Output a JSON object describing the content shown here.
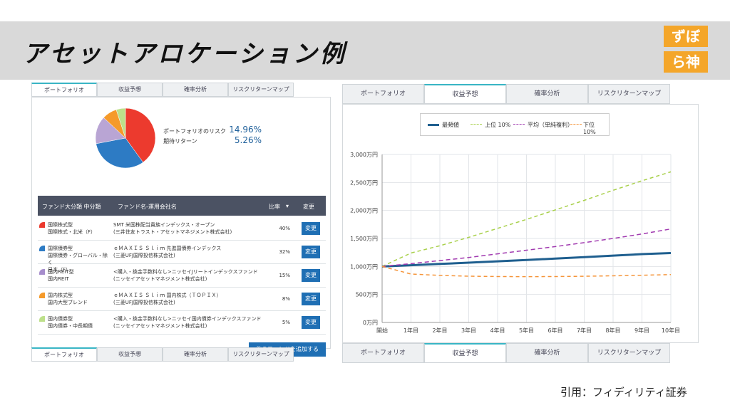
{
  "slide": {
    "title": "アセットアロケーション例",
    "logo_lines": [
      "ずぼ",
      "ら神"
    ],
    "citation": "引用：フィディリティ証券"
  },
  "tabs": [
    "ポートフォリオ",
    "収益予想",
    "確率分析",
    "リスクリターンマップ"
  ],
  "portfolio": {
    "risk_label": "ポートフォリオのリスク",
    "risk_value": "14.96%",
    "return_label": "期待リターン",
    "return_value": "5.26%",
    "pie": [
      {
        "value": 40,
        "color": "#ec3a2e"
      },
      {
        "value": 32,
        "color": "#2d7bc4"
      },
      {
        "value": 15,
        "color": "#b9a5d4"
      },
      {
        "value": 8,
        "color": "#f59a2a"
      },
      {
        "value": 5,
        "color": "#bde08a"
      }
    ],
    "table_headers": {
      "category": "ファンド大分類 中分類",
      "fund": "ファンド名-運用会社名",
      "ratio": "比率",
      "ratio_sort": "▾",
      "change": "変更"
    },
    "rows": [
      {
        "cat1": "国際株式型",
        "cat2": "国際株式・北米（F）",
        "cat3": "",
        "fund1": "SMT 米国株配当貴族インデックス・オープン",
        "fund2": "(三井住友トラスト・アセットマネジメント株式会社)",
        "ratio": "40%",
        "change": "変更",
        "color": "#ec3a2e"
      },
      {
        "cat1": "国際債券型",
        "cat2": "国際債券・グローバル・除く",
        "cat3": "日本（F）",
        "fund1": "ｅＭＡＸＩＳ Ｓｌｉｍ 先進国債券インデックス",
        "fund2": "(三菱UFJ国際投信株式会社)",
        "ratio": "32%",
        "change": "変更",
        "color": "#2d7bc4"
      },
      {
        "cat1": "国内REIT型",
        "cat2": "国内REIT",
        "cat3": "",
        "fund1": "<購入・換金手数料なし>ニッセイJリートインデックスファンド",
        "fund2": "(ニッセイアセットマネジメント株式会社)",
        "ratio": "15%",
        "change": "変更",
        "color": "#a68dcc"
      },
      {
        "cat1": "国内株式型",
        "cat2": "国内大型ブレンド",
        "cat3": "",
        "fund1": "ｅＭＡＸＩＳ Ｓｌｉｍ 国内株式（ＴＯＰＩＸ）",
        "fund2": "(三菱UFJ国際投信株式会社)",
        "ratio": "8%",
        "change": "変更",
        "color": "#f59a2a"
      },
      {
        "cat1": "国内債券型",
        "cat2": "国内債券・中長期債",
        "cat3": "",
        "fund1": "<購入・換金手数料なし>ニッセイ国内債券インデックスファンド",
        "fund2": "(ニッセイアセットマネジメント株式会社)",
        "ratio": "5%",
        "change": "変更",
        "color": "#bde08a"
      }
    ],
    "add_button": "他のファンドを追加する"
  },
  "chart_data": {
    "type": "line",
    "categories": [
      "開始",
      "1年目",
      "2年目",
      "3年目",
      "4年目",
      "5年目",
      "6年目",
      "7年目",
      "8年目",
      "9年目",
      "10年目"
    ],
    "yticks": [
      "0万円",
      "500万円",
      "1,000万円",
      "1,500万円",
      "2,000万円",
      "2,500万円",
      "3,000万円"
    ],
    "ylim": [
      0,
      3000
    ],
    "grid": true,
    "legend_position": "top",
    "series": [
      {
        "name": "最頻値",
        "color": "#1f5f8f",
        "dash": "",
        "width": 3,
        "values": [
          1000,
          1022,
          1045,
          1068,
          1092,
          1116,
          1141,
          1167,
          1193,
          1220,
          1240
        ]
      },
      {
        "name": "上位 10%",
        "color": "#a8d04a",
        "dash": "5,4",
        "width": 1.5,
        "values": [
          1000,
          1240,
          1370,
          1520,
          1680,
          1840,
          2010,
          2180,
          2360,
          2530,
          2690
        ]
      },
      {
        "name": "平均（単純複利）",
        "color": "#a13ab0",
        "dash": "6,4",
        "width": 1.5,
        "values": [
          1000,
          1050,
          1105,
          1160,
          1225,
          1290,
          1355,
          1425,
          1500,
          1580,
          1670
        ]
      },
      {
        "name": "下位 10%",
        "color": "#f5953a",
        "dash": "5,4",
        "width": 1.5,
        "values": [
          1000,
          865,
          840,
          826,
          820,
          818,
          820,
          825,
          833,
          843,
          855
        ]
      }
    ]
  }
}
